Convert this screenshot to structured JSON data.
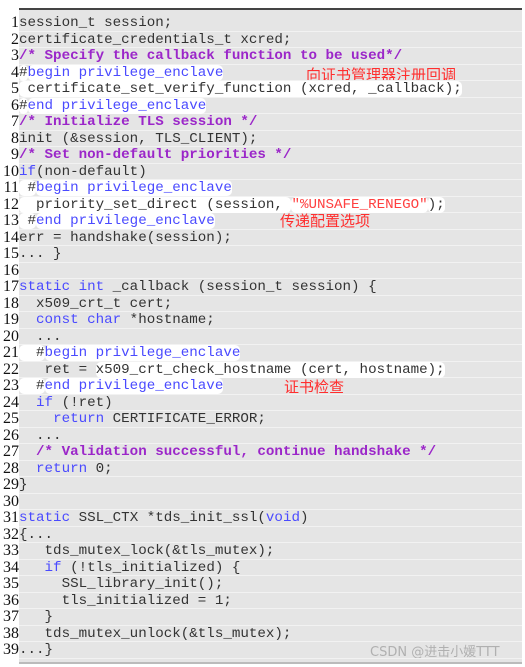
{
  "colors": {
    "keyword": "#4a4aff",
    "comment": "#9b26c9",
    "string": "#ff4040",
    "annotation": "#ff2e2e",
    "background": "#e5e5e5",
    "highlight": "#ffffff"
  },
  "lines": [
    {
      "n": "1",
      "segs": [
        {
          "t": "session_t session;"
        }
      ]
    },
    {
      "n": "2",
      "segs": [
        {
          "t": "certificate_credentials_t xcred;"
        }
      ]
    },
    {
      "n": "3",
      "segs": [
        {
          "t": "/* Specify the callback function to be used*/",
          "c": "cm"
        }
      ]
    },
    {
      "n": "4",
      "segs": [
        {
          "t": "#",
          "h": true
        },
        {
          "t": "begin privilege_enclave",
          "c": "kw",
          "h": true
        }
      ]
    },
    {
      "n": "5",
      "segs": [
        {
          "t": " certificate_set_verify_function (xcred, _callback);",
          "h": true
        }
      ]
    },
    {
      "n": "6",
      "segs": [
        {
          "t": "#",
          "h": true
        },
        {
          "t": "end privilege_enclave",
          "c": "kw",
          "h": true
        }
      ]
    },
    {
      "n": "7",
      "segs": [
        {
          "t": "/* Initialize TLS session */",
          "c": "cm"
        }
      ]
    },
    {
      "n": "8",
      "segs": [
        {
          "t": "init (&session, TLS_CLIENT);"
        }
      ]
    },
    {
      "n": "9",
      "segs": [
        {
          "t": "/* Set non-default priorities */",
          "c": "cm"
        }
      ]
    },
    {
      "n": "10",
      "segs": [
        {
          "t": "if",
          "c": "kw"
        },
        {
          "t": "(non-default)"
        }
      ]
    },
    {
      "n": "11",
      "segs": [
        {
          "t": " #",
          "h": true
        },
        {
          "t": "begin privilege_enclave",
          "c": "kw",
          "h": true
        }
      ]
    },
    {
      "n": "12",
      "segs": [
        {
          "t": "  priority_set_direct (session, ",
          "h": true
        },
        {
          "t": "\"%UNSAFE_RENEGO\"",
          "c": "str",
          "h": true
        },
        {
          "t": ");",
          "h": true
        }
      ]
    },
    {
      "n": "13",
      "segs": [
        {
          "t": " #",
          "h": true
        },
        {
          "t": "end privilege_enclave",
          "c": "kw",
          "h": true
        }
      ]
    },
    {
      "n": "14",
      "segs": [
        {
          "t": "err = handshake(session);"
        }
      ]
    },
    {
      "n": "15",
      "segs": [
        {
          "t": "... }"
        }
      ]
    },
    {
      "n": "16",
      "segs": []
    },
    {
      "n": "17",
      "segs": [
        {
          "t": "static int",
          "c": "kw"
        },
        {
          "t": " _callback (session_t session) {"
        }
      ]
    },
    {
      "n": "18",
      "segs": [
        {
          "t": "  x509_crt_t cert;"
        }
      ]
    },
    {
      "n": "19",
      "segs": [
        {
          "t": "  "
        },
        {
          "t": "const char",
          "c": "kw"
        },
        {
          "t": " *hostname;"
        }
      ]
    },
    {
      "n": "20",
      "segs": [
        {
          "t": "  ..."
        }
      ]
    },
    {
      "n": "21",
      "segs": [
        {
          "t": "  #",
          "h": true
        },
        {
          "t": "begin privilege_enclave",
          "c": "kw",
          "h": true
        }
      ]
    },
    {
      "n": "22",
      "segs": [
        {
          "t": "   ret = "
        },
        {
          "t": "x509_crt_check_hostname (cert, hostname);",
          "h": true
        }
      ]
    },
    {
      "n": "23",
      "segs": [
        {
          "t": "  #",
          "h": true
        },
        {
          "t": "end privilege_enclave",
          "c": "kw",
          "h": true
        }
      ]
    },
    {
      "n": "24",
      "segs": [
        {
          "t": "  "
        },
        {
          "t": "if",
          "c": "kw"
        },
        {
          "t": " (!ret)"
        }
      ]
    },
    {
      "n": "25",
      "segs": [
        {
          "t": "    "
        },
        {
          "t": "return",
          "c": "kw"
        },
        {
          "t": " CERTIFICATE_ERROR;"
        }
      ]
    },
    {
      "n": "26",
      "segs": [
        {
          "t": "  ..."
        }
      ]
    },
    {
      "n": "27",
      "segs": [
        {
          "t": "  "
        },
        {
          "t": "/* Validation successful, continue handshake */",
          "c": "cm"
        }
      ]
    },
    {
      "n": "28",
      "segs": [
        {
          "t": "  "
        },
        {
          "t": "return",
          "c": "kw"
        },
        {
          "t": " 0;"
        }
      ]
    },
    {
      "n": "29",
      "segs": [
        {
          "t": "}"
        }
      ]
    },
    {
      "n": "30",
      "segs": []
    },
    {
      "n": "31",
      "segs": [
        {
          "t": "static",
          "c": "kw"
        },
        {
          "t": " SSL_CTX *tds_init_ssl("
        },
        {
          "t": "void",
          "c": "kw"
        },
        {
          "t": ")"
        }
      ]
    },
    {
      "n": "32",
      "segs": [
        {
          "t": "{..."
        }
      ]
    },
    {
      "n": "33",
      "segs": [
        {
          "t": "   tds_mutex_lock(&tls_mutex);"
        }
      ]
    },
    {
      "n": "34",
      "segs": [
        {
          "t": "   "
        },
        {
          "t": "if",
          "c": "kw"
        },
        {
          "t": " (!tls_initialized) {"
        }
      ]
    },
    {
      "n": "35",
      "segs": [
        {
          "t": "     SSL_library_init();"
        }
      ]
    },
    {
      "n": "36",
      "segs": [
        {
          "t": "     tls_initialized = 1;"
        }
      ]
    },
    {
      "n": "37",
      "segs": [
        {
          "t": "   }"
        }
      ]
    },
    {
      "n": "38",
      "segs": [
        {
          "t": "   tds_mutex_unlock(&tls_mutex);"
        }
      ]
    },
    {
      "n": "39",
      "segs": [
        {
          "t": "...}"
        }
      ]
    }
  ],
  "annotations": {
    "register_callback": "向证书管理器注册回调",
    "pass_config": "传递配置选项",
    "cert_check": "证书检查"
  },
  "watermark": "CSDN @进击小媛TTT"
}
